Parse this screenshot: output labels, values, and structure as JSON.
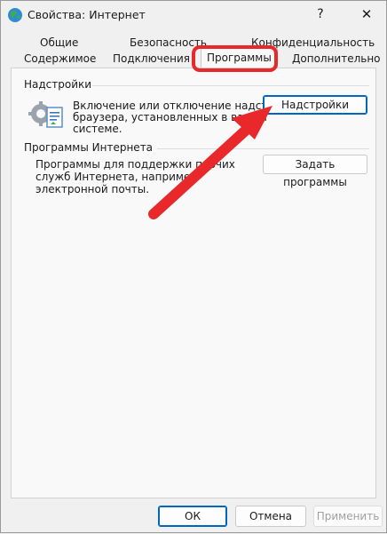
{
  "window": {
    "title": "Свойства: Интернет",
    "help_label": "?",
    "close_label": "✕"
  },
  "tabs": {
    "row1": [
      "Общие",
      "Безопасность",
      "Конфиденциальность"
    ],
    "row2": [
      "Содержимое",
      "Подключения",
      "Программы",
      "Дополнительно"
    ],
    "active": "Программы"
  },
  "addons": {
    "title": "Надстройки",
    "desc": [
      "Включение или отключение надстроек",
      "браузера, установленных в вашей",
      "системе."
    ],
    "button": "Надстройки"
  },
  "internet_programs": {
    "title": "Программы Интернета",
    "desc": [
      "Программы для поддержки прочих",
      "служб Интернета, например",
      "электронной почты."
    ],
    "button": "Задать программы"
  },
  "footer": {
    "ok": "ОК",
    "cancel": "Отмена",
    "apply": "Применить"
  },
  "colors": {
    "highlight": "#e8282a",
    "accent": "#0067c0"
  },
  "icons": {
    "app": "globe-icon",
    "addons": "gear-document-icon"
  }
}
